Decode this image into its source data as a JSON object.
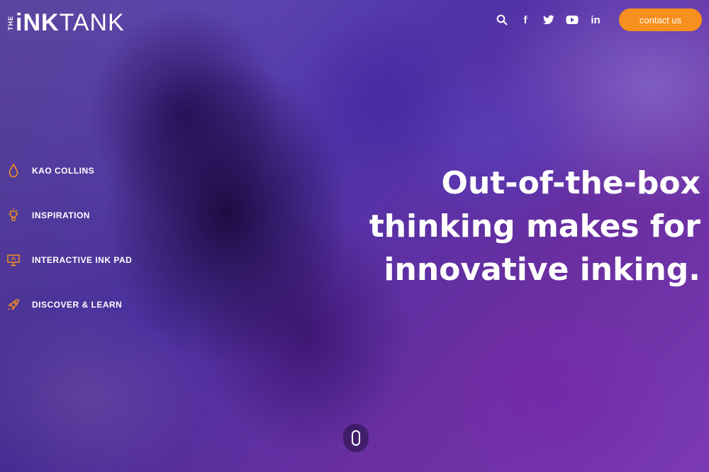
{
  "logo": {
    "the": "THE",
    "ink": "iNK",
    "tank": "TANK"
  },
  "header": {
    "contact_label": "contact us",
    "social": [
      {
        "name": "search-icon"
      },
      {
        "name": "facebook-icon",
        "glyph": "f"
      },
      {
        "name": "twitter-icon"
      },
      {
        "name": "youtube-icon"
      },
      {
        "name": "linkedin-icon",
        "glyph": "in"
      }
    ]
  },
  "sidebar": {
    "items": [
      {
        "label": "KAO COLLINS",
        "icon": "ink-drop-icon"
      },
      {
        "label": "INSPIRATION",
        "icon": "lightbulb-icon"
      },
      {
        "label": "INTERACTIVE INK PAD",
        "icon": "monitor-icon"
      },
      {
        "label": "DISCOVER & LEARN",
        "icon": "rocket-icon"
      }
    ]
  },
  "hero": {
    "lines": [
      "Out-of-the-box",
      "thinking makes for",
      "innovative inking."
    ]
  },
  "colors": {
    "accent": "#f7901e",
    "text": "#ffffff",
    "nav_icon": "#f7901e"
  }
}
